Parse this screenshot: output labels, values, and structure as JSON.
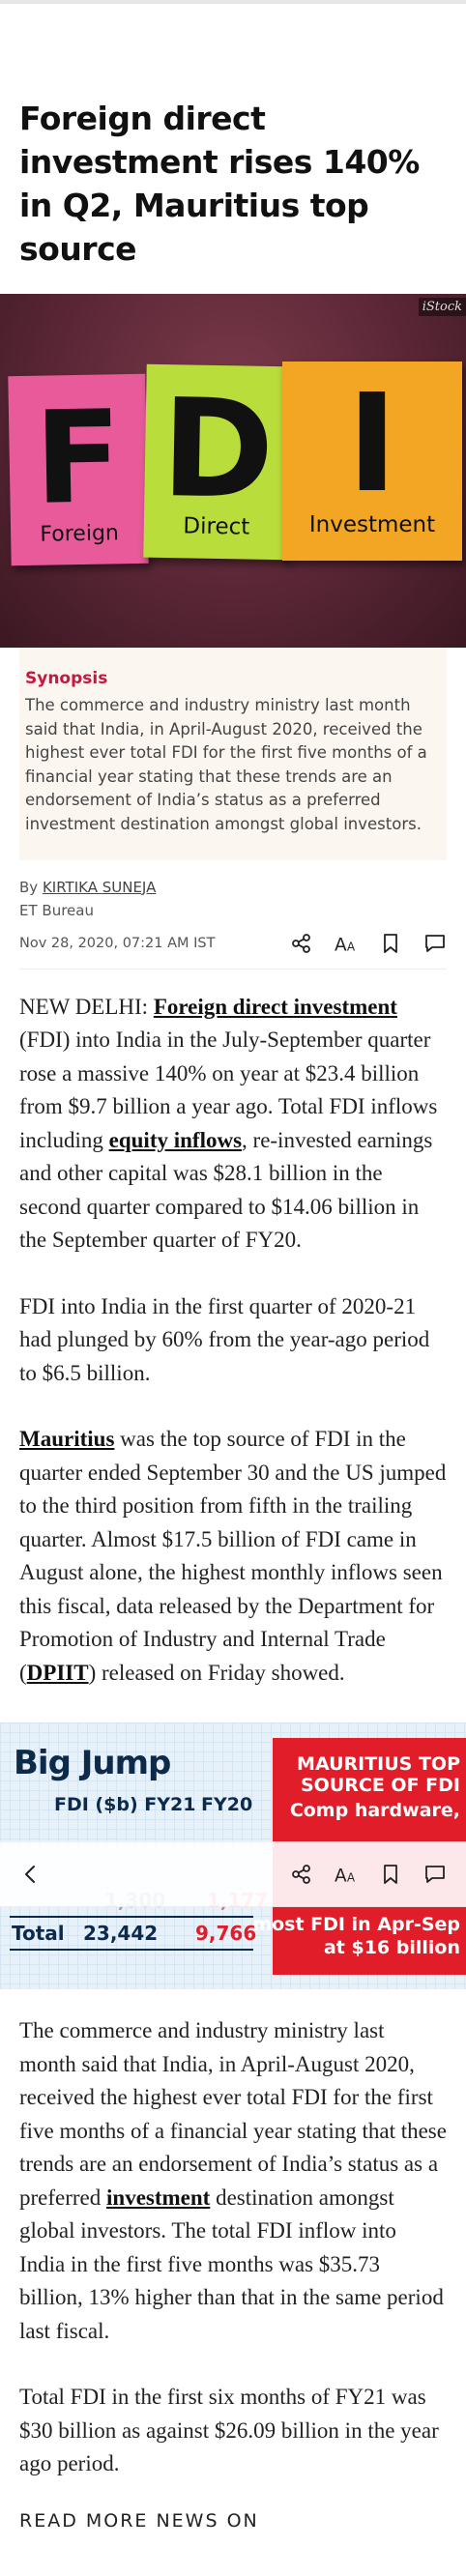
{
  "article": {
    "headline": "Foreign direct investment rises 140% in Q2, Mauritius top source",
    "image": {
      "credit": "iStock",
      "notes": [
        {
          "letter": "F",
          "word": "Foreign",
          "color": "#e85a9a"
        },
        {
          "letter": "D",
          "word": "Direct",
          "color": "#b9dd3a"
        },
        {
          "letter": "I",
          "word": "Investment",
          "color": "#f2a624"
        }
      ]
    },
    "synopsis": {
      "label": "Synopsis",
      "text": "The commerce and industry ministry last month said that India, in April-August 2020, received the highest ever total FDI for the first five months of a financial year stating that these trends are an endorsement of India’s status as a preferred investment destination amongst global investors."
    },
    "byline": {
      "prefix": "By",
      "author": "KIRTIKA SUNEJA",
      "publication": "ET Bureau",
      "date": "Nov 28, 2020, 07:21 AM IST"
    },
    "paragraphs": {
      "p1_city": "NEW DELHI: ",
      "p1_link1": "Foreign direct investment",
      "p1_text1": " (FDI) into India in the July-September quarter rose a massive 140% on year at $23.4 billion from $9.7 billion a year ago. Total FDI inflows including ",
      "p1_link2": "equity inflows",
      "p1_text2": ", re-invested earnings and other capital was $28.1 billion in the second quarter compared to $14.06 billion in the September quarter of FY20.",
      "p2": "FDI into India in the first quarter of 2020-21 had plunged by 60% from the year-ago period to $6.5 billion.",
      "p3_link": "Mauritius",
      "p3_text1": " was the top source of FDI in the quarter ended September 30 and the US jumped to the third position from fifth in the trailing quarter. Almost $17.5 billion of FDI came in August alone, the highest monthly inflows seen this fiscal, data released by the Department for Promotion of Industry and Internal Trade (",
      "p3_link2": "DPIIT",
      "p3_text2": ") released on Friday showed.",
      "p4_text1": "The commerce and industry ministry last month said that India, in April-August 2020, received the highest ever total FDI for the first five months of a financial year stating that these trends are an endorsement of India’s status as a preferred ",
      "p4_link": "investment",
      "p4_text2": " destination amongst global investors. The total FDI inflow into India in the first five months was $35.73 billion, 13% higher than that in the same period last fiscal.",
      "p5": "Total FDI in the first six months of FY21 was $30 billion as against $26.09 billion in the year ago period."
    },
    "infographic": {
      "title": "Big Jump",
      "col1": "FDI ($b) FY21",
      "col2": "FY20",
      "right_top1": "MAURITIUS TOP",
      "right_top2": "SOURCE OF FDI",
      "right_mid": "Comp hardware,",
      "right_bot1": "most FDI in Apr-Sep",
      "right_bot2": "at $16 billion",
      "total_label": "Total",
      "total_fy21": "23,442",
      "total_fy20": "9,766",
      "partial_row_fy21": "1,300",
      "partial_row_fy20": "1,177"
    },
    "read_more": "READ MORE NEWS ON"
  },
  "toolbar": {
    "icons": [
      "share-icon",
      "font-size-icon",
      "bookmark-icon",
      "comment-icon"
    ],
    "font_label": "AA"
  },
  "overlay": {
    "back_icon": "chevron-left-icon"
  }
}
